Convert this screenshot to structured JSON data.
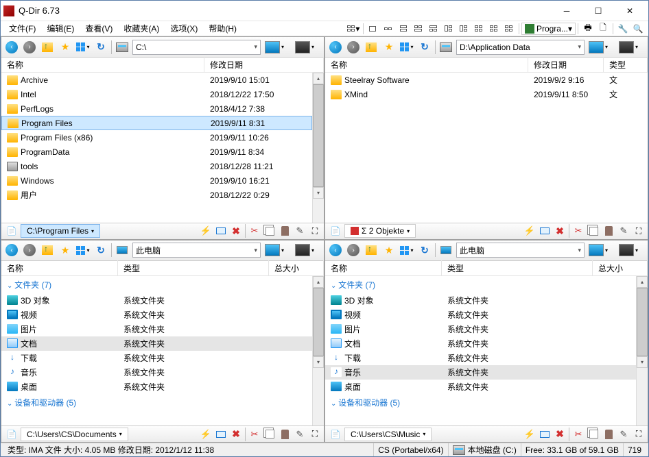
{
  "window": {
    "title": "Q-Dir 6.73"
  },
  "menu": {
    "file": "文件(F)",
    "edit": "编辑(E)",
    "view": "查看(V)",
    "fav": "收藏夹(A)",
    "opt": "选项(X)",
    "help": "帮助(H)",
    "progra": "Progra..."
  },
  "cols": {
    "name": "名称",
    "modified": "修改日期",
    "type": "类型",
    "size": "总大小",
    "typeCol": "类型"
  },
  "paneTL": {
    "addr": "C:\\",
    "rows": [
      {
        "name": "Archive",
        "date": "2019/9/10 15:01"
      },
      {
        "name": "Intel",
        "date": "2018/12/22 17:50"
      },
      {
        "name": "PerfLogs",
        "date": "2018/4/12 7:38"
      },
      {
        "name": "Program Files",
        "date": "2019/9/11 8:31",
        "sel": true
      },
      {
        "name": "Program Files (x86)",
        "date": "2019/9/11 10:26"
      },
      {
        "name": "ProgramData",
        "date": "2019/9/11 8:34"
      },
      {
        "name": "tools",
        "date": "2018/12/28 11:21",
        "drive": true
      },
      {
        "name": "Windows",
        "date": "2019/9/10 16:21"
      },
      {
        "name": "用户",
        "date": "2018/12/22 0:29"
      }
    ],
    "tab": "C:\\Program Files"
  },
  "paneTR": {
    "addr": "D:\\Application Data",
    "rows": [
      {
        "name": "Steelray Software",
        "date": "2019/9/2 9:16",
        "t": "文"
      },
      {
        "name": "XMind",
        "date": "2019/9/11 8:50",
        "t": "文"
      }
    ],
    "tab": "Σ 2 Objekte"
  },
  "paneBL": {
    "addr": "此电脑",
    "grp1": "文件夹 (7)",
    "rows": [
      {
        "name": "3D 对象",
        "type": "系统文件夹",
        "ico": "obj3d"
      },
      {
        "name": "视频",
        "type": "系统文件夹",
        "ico": "video"
      },
      {
        "name": "图片",
        "type": "系统文件夹",
        "ico": "pic"
      },
      {
        "name": "文档",
        "type": "系统文件夹",
        "ico": "doc",
        "sel": true
      },
      {
        "name": "下载",
        "type": "系统文件夹",
        "ico": "down"
      },
      {
        "name": "音乐",
        "type": "系统文件夹",
        "ico": "music"
      },
      {
        "name": "桌面",
        "type": "系统文件夹",
        "ico": "desk"
      }
    ],
    "grp2": "设备和驱动器 (5)",
    "tab": "C:\\Users\\CS\\Documents"
  },
  "paneBR": {
    "addr": "此电脑",
    "grp1": "文件夹 (7)",
    "rows": [
      {
        "name": "3D 对象",
        "type": "系统文件夹",
        "ico": "obj3d"
      },
      {
        "name": "视频",
        "type": "系统文件夹",
        "ico": "video"
      },
      {
        "name": "图片",
        "type": "系统文件夹",
        "ico": "pic"
      },
      {
        "name": "文档",
        "type": "系统文件夹",
        "ico": "doc"
      },
      {
        "name": "下载",
        "type": "系统文件夹",
        "ico": "down"
      },
      {
        "name": "音乐",
        "type": "系统文件夹",
        "ico": "music",
        "sel": true
      },
      {
        "name": "桌面",
        "type": "系统文件夹",
        "ico": "desk"
      }
    ],
    "grp2": "设备和驱动器 (5)",
    "tab": "C:\\Users\\CS\\Music"
  },
  "status": {
    "left": "类型: IMA 文件 大小: 4.05 MB 修改日期: 2012/1/12 11:38",
    "mid": "CS (Portabel/x64)",
    "drive": "本地磁盘 (C:)",
    "free": "Free: 33.1 GB of 59.1 GB",
    "num": "719"
  }
}
